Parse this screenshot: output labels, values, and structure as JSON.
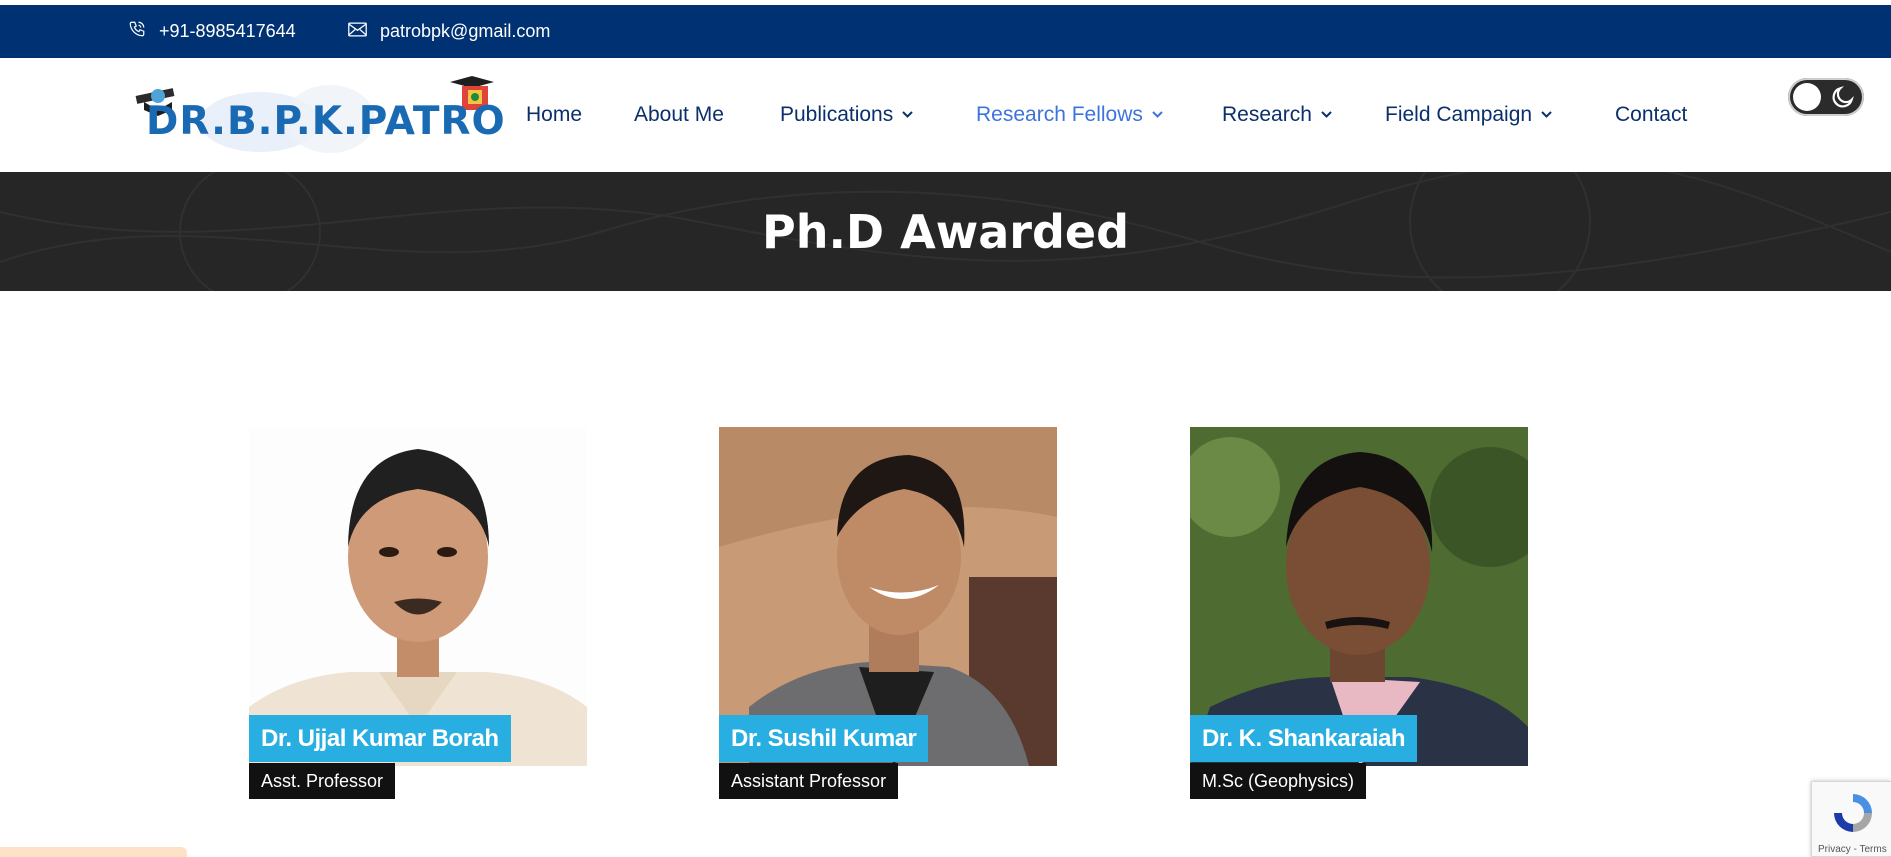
{
  "topbar": {
    "phone": "+91-8985417644",
    "email": "patrobpk@gmail.com",
    "background": "#003173"
  },
  "header": {
    "logo_text": "DR.B.P.K.PATRO",
    "nav": [
      {
        "label": "Home",
        "dropdown": false,
        "active": false
      },
      {
        "label": "About Me",
        "dropdown": false,
        "active": false
      },
      {
        "label": "Publications",
        "dropdown": true,
        "active": false
      },
      {
        "label": "Research Fellows",
        "dropdown": true,
        "active": true
      },
      {
        "label": "Research",
        "dropdown": true,
        "active": false
      },
      {
        "label": "Field Campaign",
        "dropdown": true,
        "active": false
      },
      {
        "label": "Contact",
        "dropdown": false,
        "active": false
      }
    ],
    "theme_toggle": {
      "mode": "light",
      "icon": "moon-icon"
    }
  },
  "hero": {
    "title": "Ph.D Awarded"
  },
  "people": [
    {
      "name": "Dr. Ujjal Kumar Borah",
      "role": "Asst. Professor"
    },
    {
      "name": "Dr. Sushil Kumar",
      "role": "Assistant Professor"
    },
    {
      "name": "Dr. K. Shankaraiah",
      "role": "M.Sc (Geophysics)"
    }
  ],
  "recaptcha": {
    "links": "Privacy - Terms"
  },
  "colors": {
    "nav_text": "#0b2f6b",
    "nav_active": "#3d74dc",
    "name_badge": "#29aee2",
    "role_badge": "#111111",
    "hero_bg": "#262626"
  }
}
